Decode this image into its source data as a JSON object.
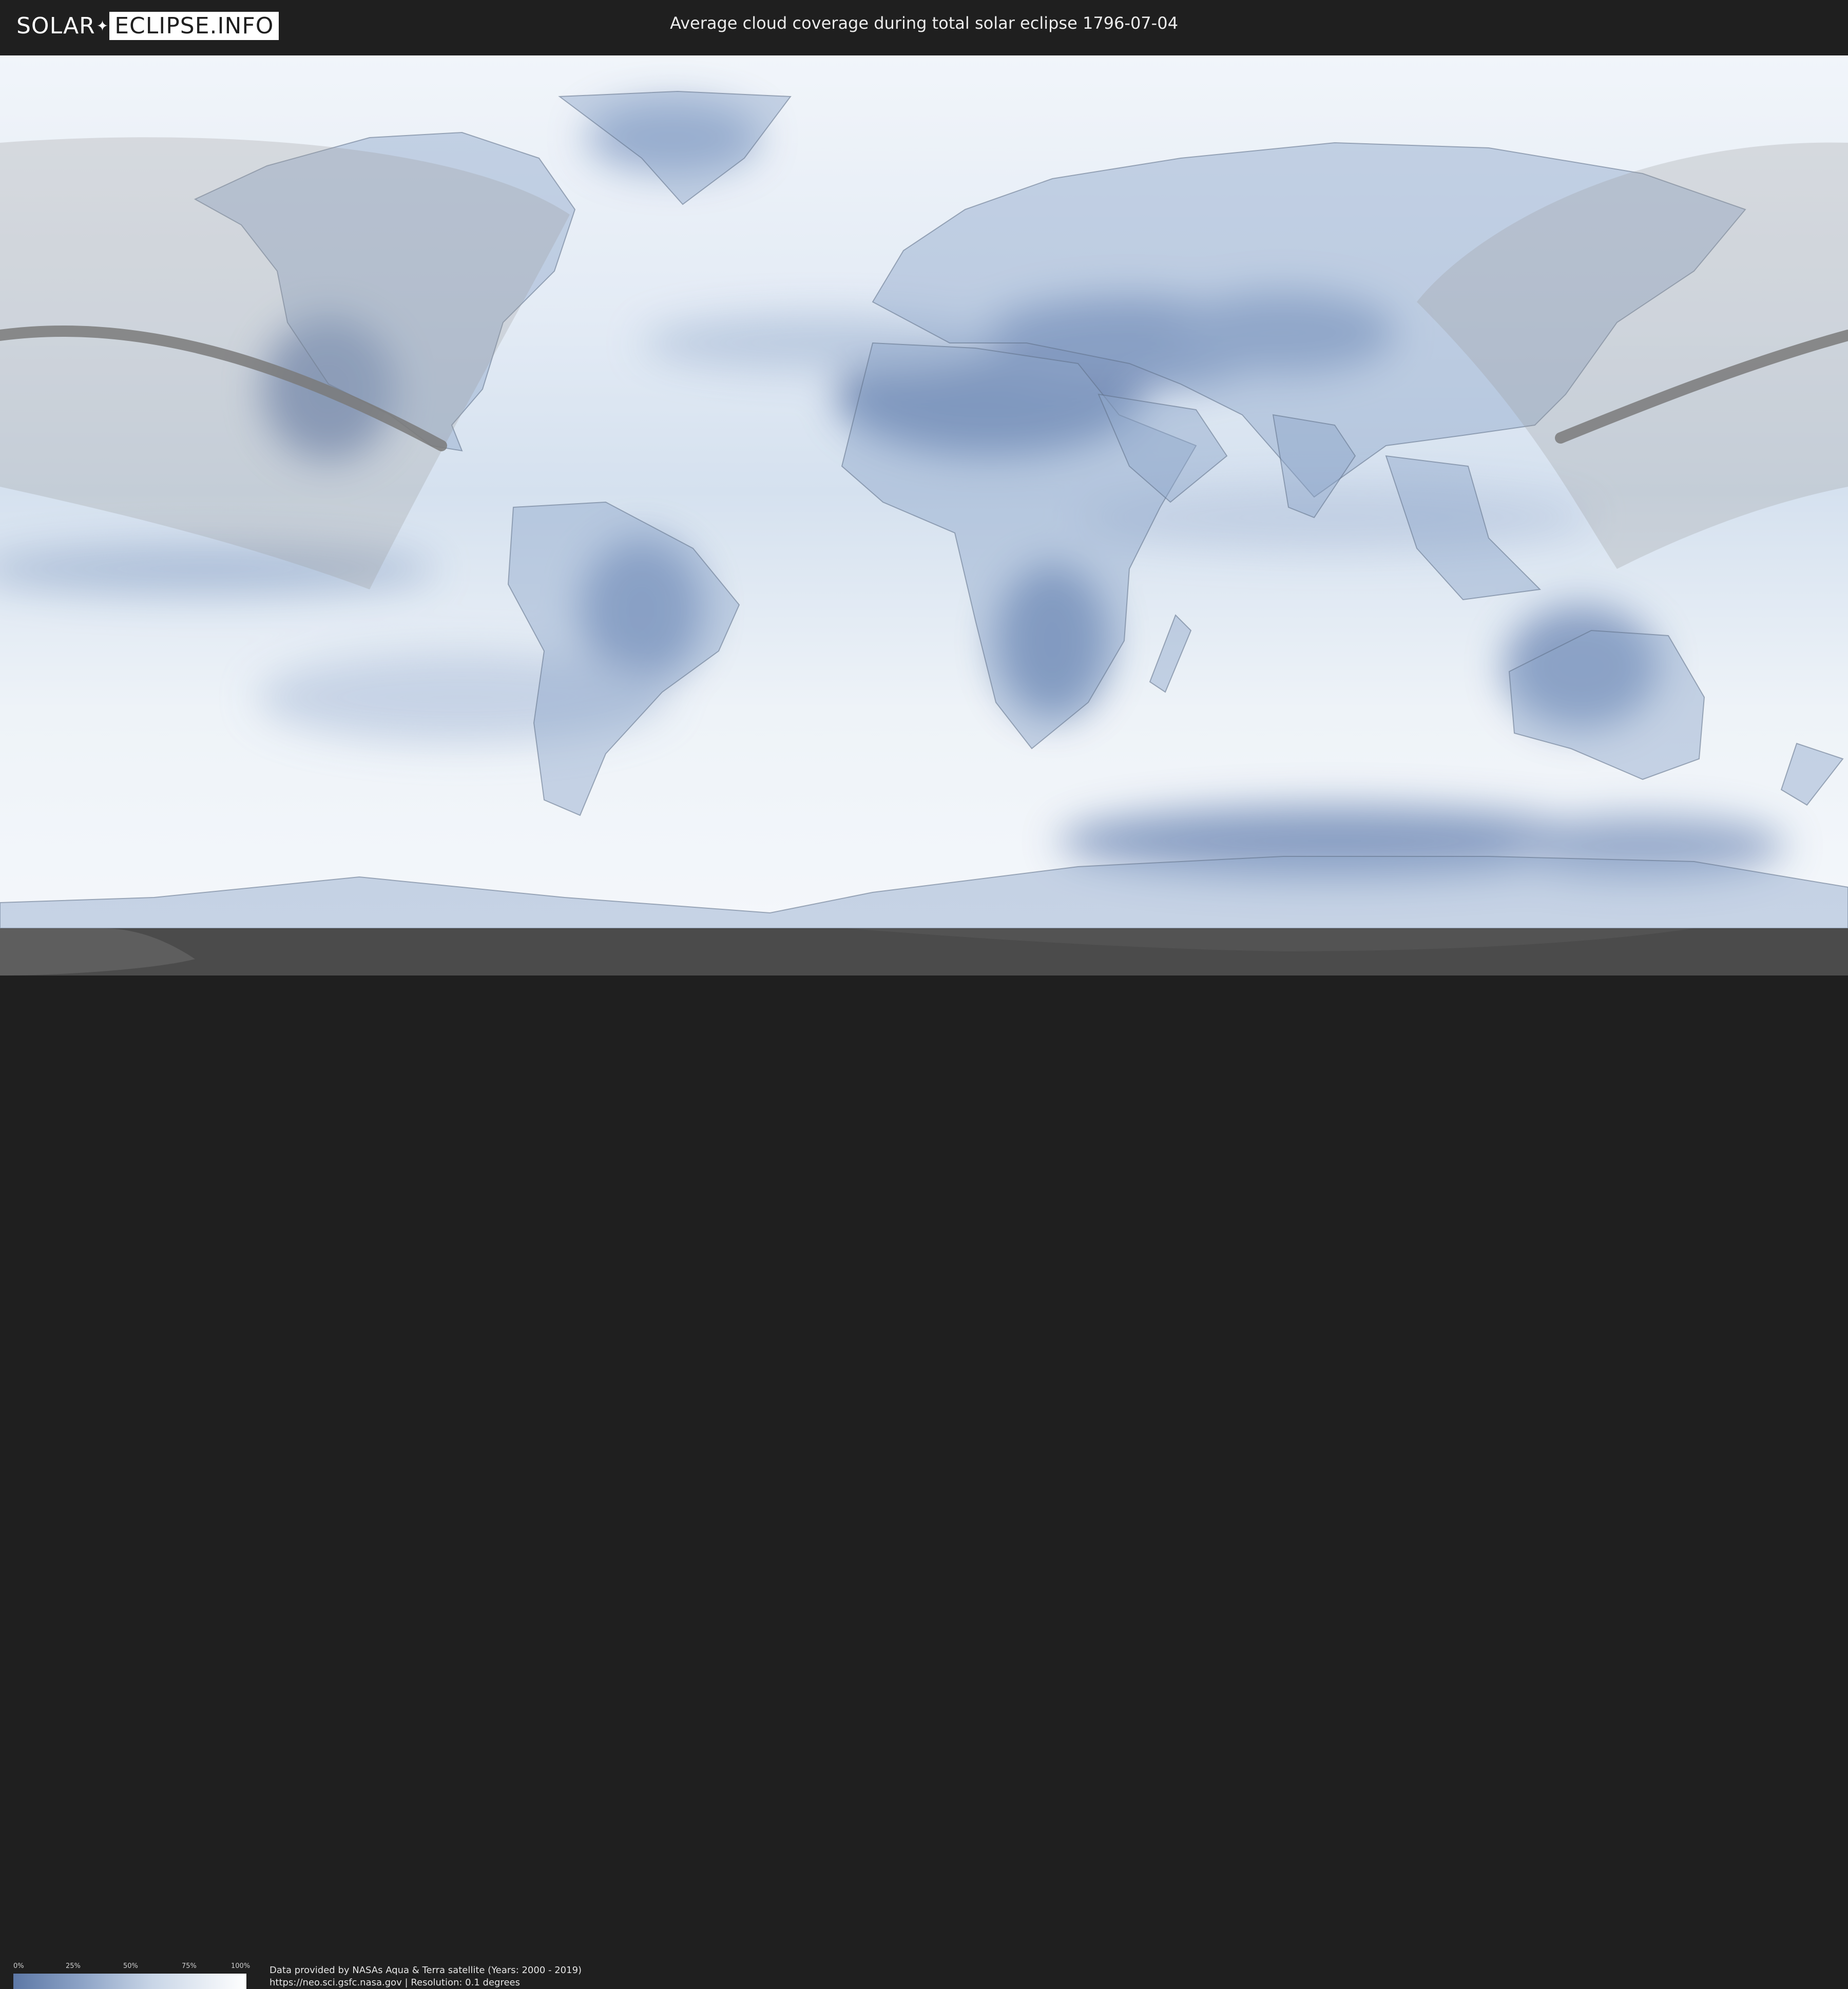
{
  "logo": {
    "part1": "SOLAR",
    "part2": "ECLIPSE.INFO"
  },
  "title": "Average cloud coverage during total solar eclipse 1796-07-04",
  "legend": {
    "labels": [
      "0%",
      "25%",
      "50%",
      "75%",
      "100%"
    ]
  },
  "credits": {
    "line1": "Data provided by NASAs Aqua & Terra satellite (Years: 2000 - 2019)",
    "line2": "https://neo.sci.gsfc.nasa.gov | Resolution: 0.1 degrees"
  },
  "colors": {
    "cloud_low": "#5d78a6",
    "cloud_high": "#ffffff",
    "eclipse_path": "#7a7a7a",
    "shadow_region": "#9a9a9a"
  }
}
